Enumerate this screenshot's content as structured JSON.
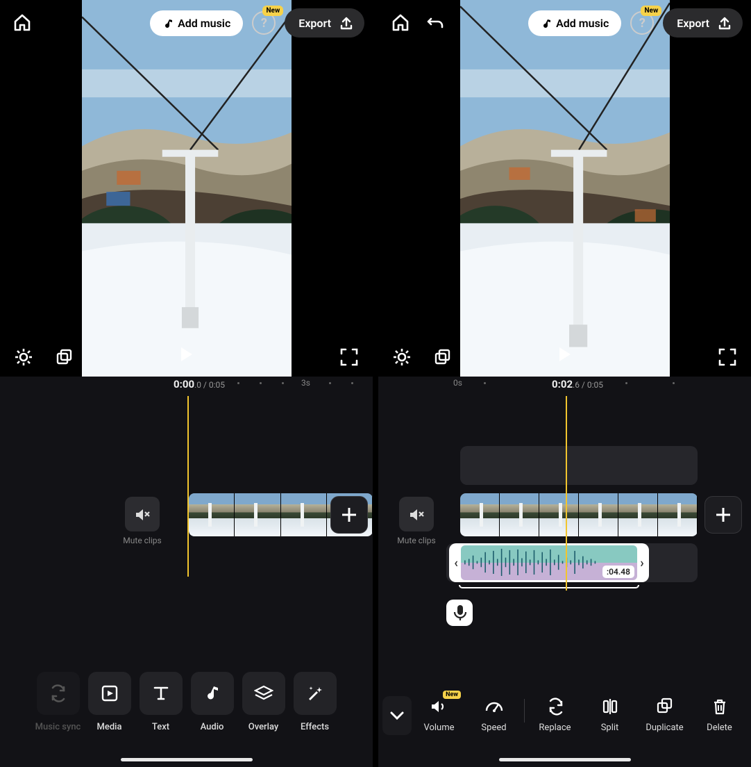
{
  "header": {
    "add_music": "Add music",
    "new_badge": "New",
    "export": "Export"
  },
  "left": {
    "time_main": "0:00",
    "time_sub": ".0 / 0:05",
    "tick_label": "3s",
    "mute_label": "Mute clips",
    "tools": [
      {
        "key": "music-sync",
        "label": "Music sync",
        "disabled": true
      },
      {
        "key": "media",
        "label": "Media"
      },
      {
        "key": "text",
        "label": "Text"
      },
      {
        "key": "audio",
        "label": "Audio"
      },
      {
        "key": "overlay",
        "label": "Overlay"
      },
      {
        "key": "effects",
        "label": "Effects"
      }
    ]
  },
  "right": {
    "time_main": "0:02",
    "time_sub": ".6 / 0:05",
    "tick_label": "0s",
    "mute_label": "Mute clips",
    "audio_duration": ":04.48",
    "new_badge": "New",
    "tools": [
      {
        "key": "volume",
        "label": "Volume"
      },
      {
        "key": "speed",
        "label": "Speed"
      },
      {
        "key": "replace",
        "label": "Replace"
      },
      {
        "key": "split",
        "label": "Split"
      },
      {
        "key": "duplicate",
        "label": "Duplicate"
      },
      {
        "key": "delete",
        "label": "Delete"
      }
    ]
  }
}
